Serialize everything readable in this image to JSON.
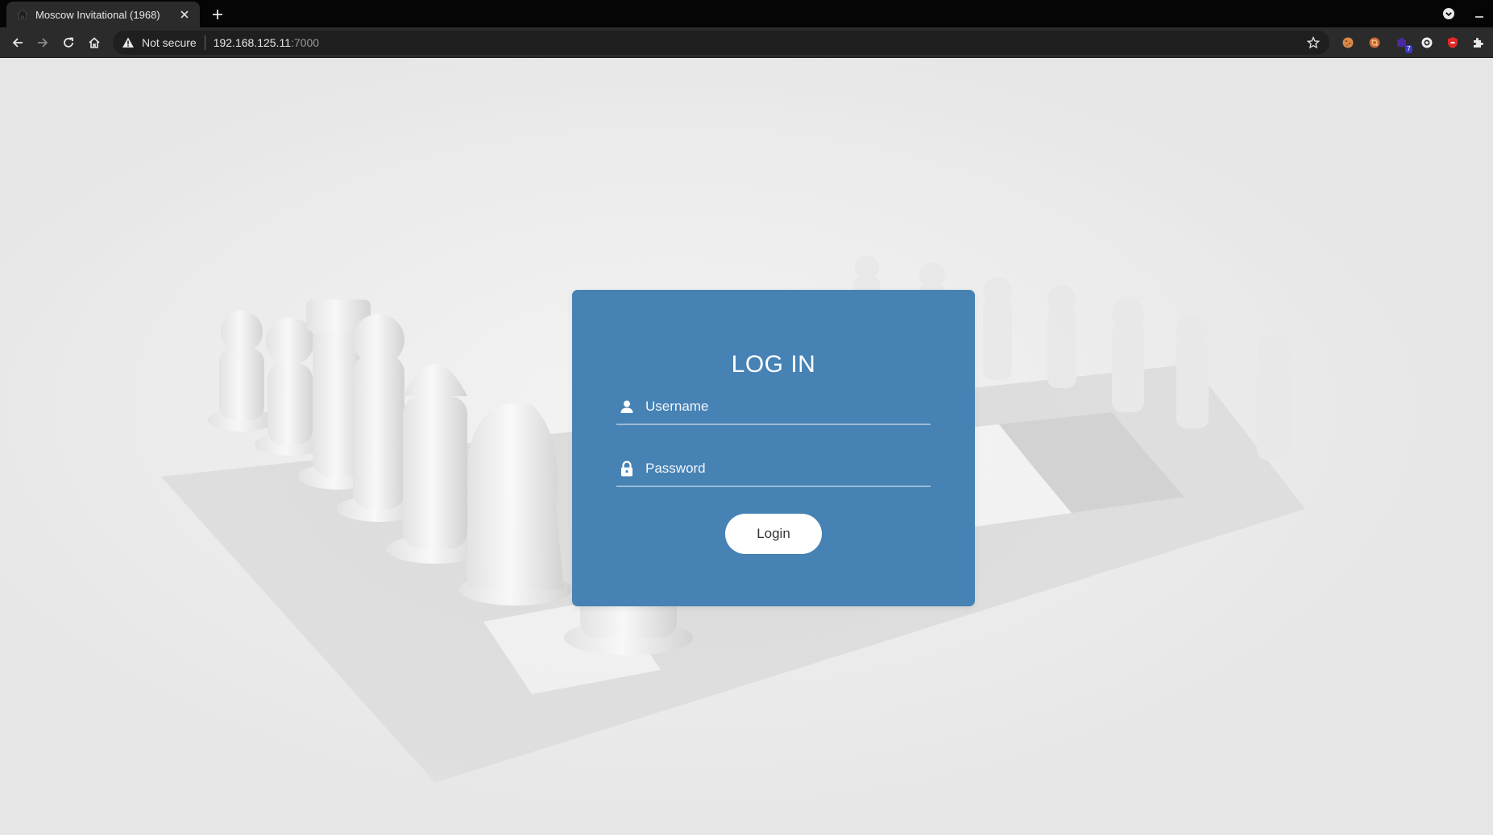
{
  "browser": {
    "tab": {
      "title": "Moscow Invitational (1968)",
      "favicon": "house-icon"
    },
    "address": {
      "security_label": "Not secure",
      "host": "192.168.125.11",
      "port": ":7000"
    },
    "extensions": [
      "cookie-icon",
      "cookie-alt-icon",
      "puzzle-badge-icon",
      "circle-icon",
      "shield-red-icon",
      "puzzle-icon"
    ],
    "extension_badge": "7"
  },
  "login": {
    "title": "LOG IN",
    "username_placeholder": "Username",
    "username_value": "",
    "password_placeholder": "Password",
    "password_value": "",
    "button_label": "Login"
  },
  "colors": {
    "card": "#4682b4",
    "background": "#e6e6e6",
    "tabbar": "#050505",
    "toolbar": "#2b2b2b"
  }
}
